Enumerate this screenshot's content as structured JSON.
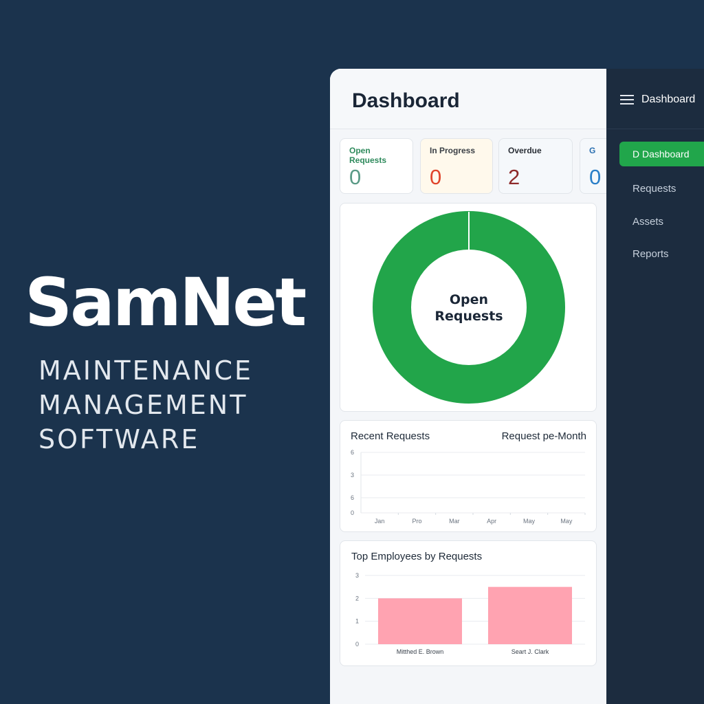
{
  "brand": {
    "name": "SamNet",
    "tagline": [
      "MAINTENANCE",
      "MANAGEMENT",
      "SOFTWARE"
    ]
  },
  "header": {
    "title": "Dashboard"
  },
  "stats": [
    {
      "label": "Open Requests",
      "value": "0",
      "color": "#2e8a5c",
      "value_color": "#5a9a86",
      "bg": "#ffffff"
    },
    {
      "label": "In Progress",
      "value": "0",
      "color": "#3a3f45",
      "value_color": "#e0452c",
      "bg": "#fff9ec"
    },
    {
      "label": "Overdue",
      "value": "2",
      "color": "#2a2f36",
      "value_color": "#8e2a2a",
      "bg": "#f5f8fb"
    },
    {
      "label": "G",
      "value": "0",
      "color": "#2a6fb0",
      "value_color": "#2a7fc8",
      "bg": "#f5f8fb"
    }
  ],
  "donut": {
    "label": [
      "Open",
      "Requests"
    ],
    "color": "#22a54a"
  },
  "recent": {
    "title": "Recent Requests",
    "subtitle": "Request pe-Month",
    "chart_data": {
      "type": "line",
      "categories": [
        "Jan",
        "Pro",
        "Mar",
        "Apr",
        "May",
        "May"
      ],
      "y_tick_labels": [
        "6",
        "3",
        "6",
        "0"
      ],
      "series": [],
      "grid": true
    }
  },
  "top_employees": {
    "title": "Top Employees by Requests",
    "chart_data": {
      "type": "bar",
      "categories": [
        "Mitthed E. Brown",
        "Seart J. Clark"
      ],
      "values": [
        2,
        2.5
      ],
      "ylim": [
        0,
        3
      ],
      "y_tick_labels": [
        "3",
        "2",
        "1",
        "0"
      ],
      "color": "#ffa3b1",
      "grid": true
    }
  },
  "sidebar": {
    "title": "Dashboard",
    "items": [
      {
        "label": "D Dashboard",
        "active": true
      },
      {
        "label": "Requests",
        "active": false
      },
      {
        "label": "Assets",
        "active": false
      },
      {
        "label": "Reports",
        "active": false
      }
    ]
  }
}
